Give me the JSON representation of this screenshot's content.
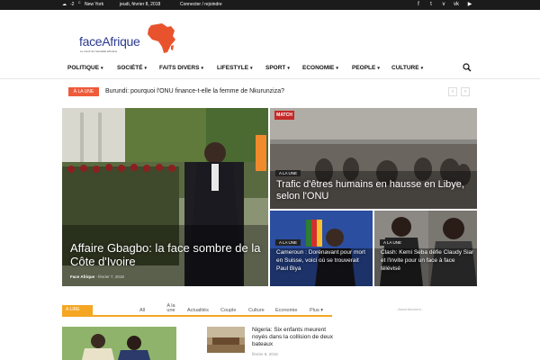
{
  "topbar": {
    "weather": "-2",
    "weather_unit": "C",
    "city": "New York",
    "date": "jeudi, février 8, 2018",
    "login": "Connecter / rejoindre",
    "social": [
      "facebook-icon",
      "twitter-icon",
      "vimeo-icon",
      "vk-icon",
      "youtube-icon"
    ]
  },
  "logo": {
    "word_a": "face",
    "word_b": "Afrique",
    "tagline": "Le miroir de l'actualité africaine"
  },
  "nav": {
    "items": [
      "POLITIQUE",
      "SOCIÉTÉ",
      "FAITS DIVERS",
      "LIFESTYLE",
      "SPORT",
      "ECONOMIE",
      "PEOPLE",
      "CULTURE"
    ]
  },
  "ticker": {
    "badge": "À LA UNE",
    "headline": "Burundi: pourquoi l'ONU finance-t-elle la femme de Nkurunziza?"
  },
  "featured": {
    "main": {
      "title": "Affaire Gbagbo: la face sombre de la Côte d'Ivoire",
      "author": "Face Afrique",
      "date": "février 7, 2018"
    },
    "top_right": {
      "category": "A LA UNE",
      "title": "Trafic d'êtres humains en hausse en Libye, selon l'ONU",
      "overlay_logo": "MATCH"
    },
    "bottom_left": {
      "category": "A LA UNE",
      "title": "Cameroun : Dorénavant pour mort en Suisse, voici où se trouverait Paul Biya"
    },
    "bottom_right": {
      "category": "A LA UNE",
      "title": "Clash: Kemi Seba défie Claudy Siar et l'invite pour un face à face télévisé"
    }
  },
  "block": {
    "label": "A LIRE",
    "tabs": [
      "All",
      "A la une",
      "Actualités",
      "Couple",
      "Culture",
      "Economie",
      "Plus"
    ],
    "advert": "- Advertisement -",
    "post": {
      "title": "Nigeria: Six enfants meurent noyés dans la collision de deux bateaux",
      "date": "février 8, 2018"
    }
  },
  "colors": {
    "accent": "#ef5a3a",
    "block_accent": "#f5a623",
    "topbar": "#1b1b1b",
    "logo_blue": "#2c3a8e",
    "logo_map": "#e8532e"
  }
}
